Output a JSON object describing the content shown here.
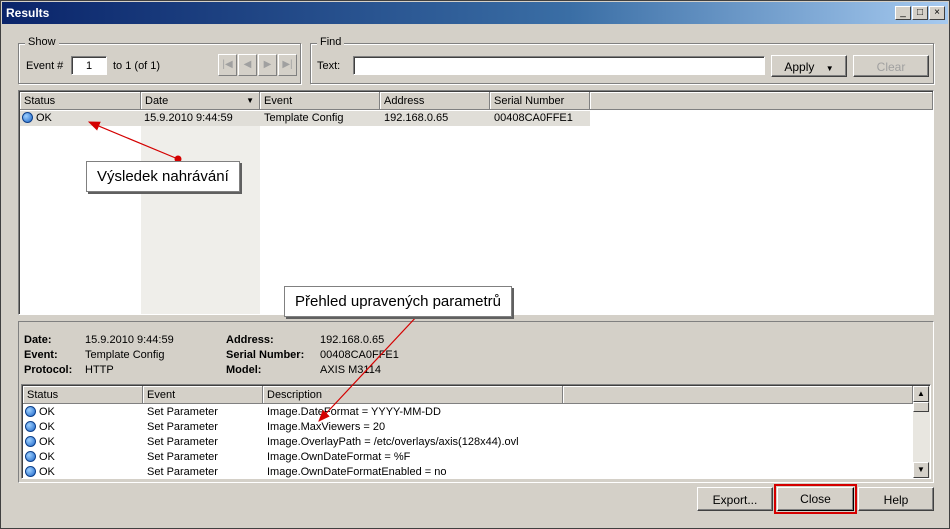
{
  "window": {
    "title": "Results",
    "controls": [
      "_",
      "□",
      "×"
    ]
  },
  "show": {
    "legend": "Show",
    "event_label": "Event #",
    "event_value": "1",
    "range_text": "to 1 (of 1)"
  },
  "find": {
    "legend": "Find",
    "text_label": "Text:",
    "text_value": "",
    "apply_label": "Apply",
    "clear_label": "Clear"
  },
  "events_table": {
    "columns": [
      "Status",
      "Date",
      "Event",
      "Address",
      "Serial Number"
    ],
    "rows": [
      {
        "status": "OK",
        "date": "15.9.2010 9:44:59",
        "event": "Template Config",
        "address": "192.168.0.65",
        "serial": "00408CA0FFE1"
      }
    ]
  },
  "callouts": {
    "upload_result": "Výsledek nahrávání",
    "params_overview": "Přehled upravených parametrů"
  },
  "details": {
    "date_label": "Date:",
    "date_value": "15.9.2010 9:44:59",
    "event_label": "Event:",
    "event_value": "Template Config",
    "protocol_label": "Protocol:",
    "protocol_value": "HTTP",
    "address_label": "Address:",
    "address_value": "192.168.0.65",
    "serial_label": "Serial Number:",
    "serial_value": "00408CA0FFE1",
    "model_label": "Model:",
    "model_value": "AXIS M3114"
  },
  "params_table": {
    "columns": [
      "Status",
      "Event",
      "Description"
    ],
    "rows": [
      {
        "status": "OK",
        "event": "Set Parameter",
        "description": "Image.DateFormat = YYYY-MM-DD"
      },
      {
        "status": "OK",
        "event": "Set Parameter",
        "description": "Image.MaxViewers = 20"
      },
      {
        "status": "OK",
        "event": "Set Parameter",
        "description": "Image.OverlayPath = /etc/overlays/axis(128x44).ovl"
      },
      {
        "status": "OK",
        "event": "Set Parameter",
        "description": "Image.OwnDateFormat = %F"
      },
      {
        "status": "OK",
        "event": "Set Parameter",
        "description": "Image.OwnDateFormatEnabled = no"
      }
    ]
  },
  "buttons": {
    "export": "Export...",
    "close": "Close",
    "help": "Help"
  },
  "colors": {
    "highlight": "#d40000",
    "titlebar": "#0a246a"
  }
}
